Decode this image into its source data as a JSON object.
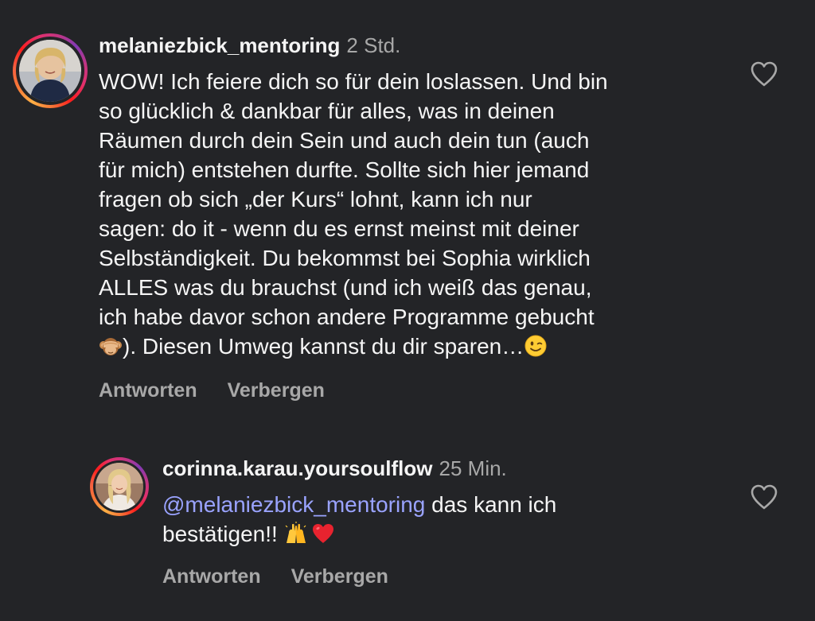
{
  "comments": [
    {
      "username": "melaniezbick_mentoring",
      "time": "2 Std.",
      "avatar": "avatar-blonde-woman-dark-top",
      "lines": [
        "WOW! Ich feiere dich so für dein loslassen. Und bin",
        "so glücklich & dankbar für alles, was in deinen",
        "Räumen durch dein Sein und auch dein tun (auch",
        "für mich) entstehen durfte. Sollte sich hier jemand",
        "fragen ob sich „der Kurs“ lohnt, kann ich nur",
        "sagen: do it - wenn du es ernst meinst mit deiner",
        "Selbständigkeit. Du bekommst bei Sophia wirklich",
        "ALLES was du brauchst (und ich weiß das genau,",
        "ich habe davor schon andere Programme gebucht"
      ],
      "last_line_emoji_1": "see-no-evil-monkey-emoji",
      "last_line_text": "). Diesen Umweg kannst du dir sparen…",
      "last_line_emoji_2": "winking-face-emoji",
      "reply_label": "Antworten",
      "hide_label": "Verbergen",
      "like_icon": "heart-outline-icon"
    },
    {
      "username": "corinna.karau.yoursoulflow",
      "time": "25 Min.",
      "avatar": "avatar-blonde-woman-light-top",
      "mention": "@melaniezbick_mentoring",
      "line1_rest": " das kann ich",
      "line2_text": "bestätigen!! ",
      "emoji_1": "raising-hands-emoji",
      "emoji_2": "red-heart-emoji",
      "reply_label": "Antworten",
      "hide_label": "Verbergen",
      "like_icon": "heart-outline-icon"
    }
  ],
  "colors": {
    "background": "#232427",
    "text": "#f5f5f5",
    "secondary": "#a8a8a8",
    "mention": "#9aa3ff"
  }
}
